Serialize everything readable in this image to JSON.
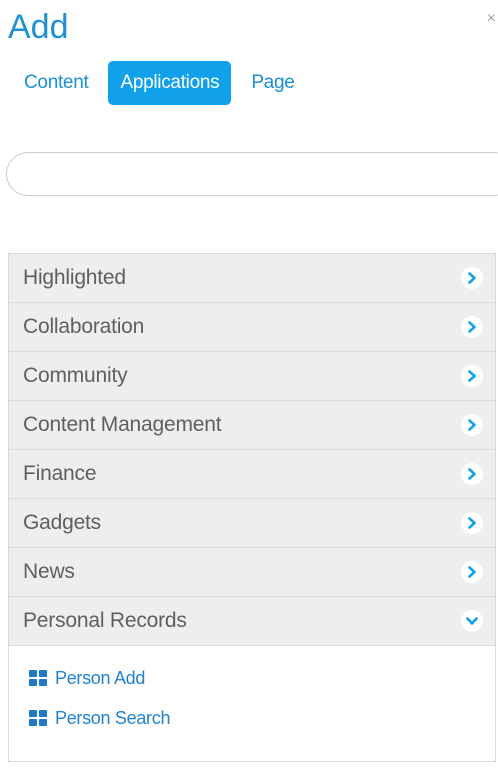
{
  "header": {
    "title": "Add",
    "close_icon": "×"
  },
  "tabs": [
    {
      "label": "Content",
      "active": false
    },
    {
      "label": "Applications",
      "active": true
    },
    {
      "label": "Page",
      "active": false
    }
  ],
  "search": {
    "value": "",
    "placeholder": ""
  },
  "categories": [
    {
      "label": "Highlighted",
      "icon": "chevron-right-icon",
      "expanded": false
    },
    {
      "label": "Collaboration",
      "icon": "chevron-right-icon",
      "expanded": false
    },
    {
      "label": "Community",
      "icon": "chevron-right-icon",
      "expanded": false
    },
    {
      "label": "Content Management",
      "icon": "chevron-right-icon",
      "expanded": false
    },
    {
      "label": "Finance",
      "icon": "chevron-right-icon",
      "expanded": false
    },
    {
      "label": "Gadgets",
      "icon": "chevron-right-icon",
      "expanded": false
    },
    {
      "label": "News",
      "icon": "chevron-right-icon",
      "expanded": false
    },
    {
      "label": "Personal Records",
      "icon": "chevron-down-icon",
      "expanded": true
    }
  ],
  "personal_records_apps": [
    {
      "label": "Person Add",
      "icon": "grid-icon"
    },
    {
      "label": "Person Search",
      "icon": "grid-icon"
    }
  ],
  "colors": {
    "accent": "#10a1ea",
    "link": "#1f83cf",
    "title": "#1f8fd6",
    "row_bg": "#eeeeee"
  }
}
